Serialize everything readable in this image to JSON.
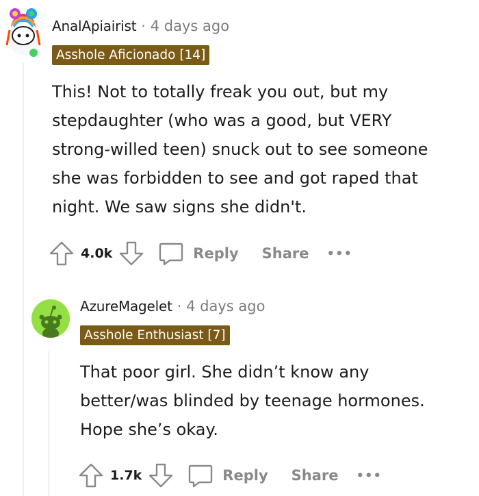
{
  "comment1": {
    "username": "AnalApiairist",
    "separator": "·",
    "timestamp": "4 days ago",
    "flair": "Asshole Aficionado [14]",
    "body_lines": [
      "This! Not to totally freak you out, but my",
      "stepdaughter (who was a good, but VERY",
      "strong-willed teen) snuck out to see someone",
      "she was forbidden to see and got raped that",
      "night. We saw signs she didn't."
    ],
    "score": "4.0k",
    "reply_label": "Reply",
    "share_label": "Share",
    "more_label": "•••"
  },
  "comment2": {
    "username": "AzureMagelet",
    "separator": "·",
    "timestamp": "4 days ago",
    "flair": "Asshole Enthusiast [7]",
    "body_lines": [
      "That poor girl. She didn’t know any",
      "better/was blinded by teenage hormones.",
      "Hope she’s okay."
    ],
    "score": "1.7k",
    "reply_label": "Reply",
    "share_label": "Share",
    "more_label": "•••"
  },
  "icons": {
    "upvote": "upvote-arrow-icon",
    "downvote": "downvote-arrow-icon",
    "comment": "speech-bubble-icon",
    "more": "ellipsis-icon",
    "avatar1": "snoo-avatar-rainbow-hair",
    "avatar2": "snoo-avatar-default"
  },
  "colors": {
    "flair_bg": "#7b5a18",
    "online": "#46d160",
    "avatar2_bg": "#94e044",
    "muted": "#878a8c"
  }
}
